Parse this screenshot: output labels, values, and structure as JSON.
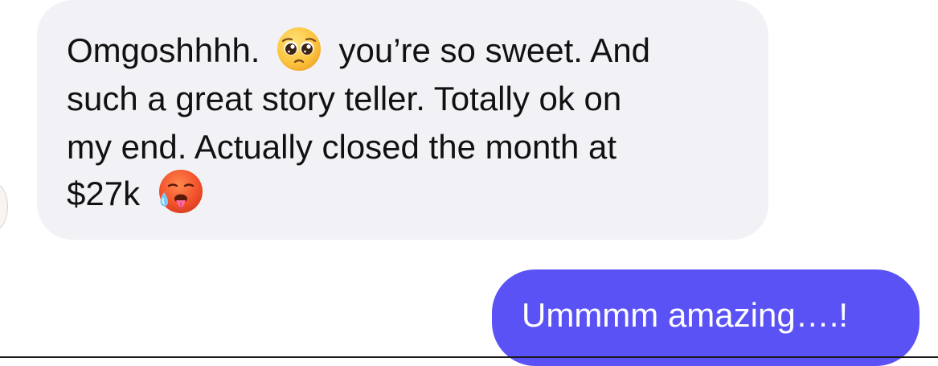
{
  "incoming_message": {
    "lines": [
      {
        "before": "Omgoshhhh.",
        "emoji": "pleading-face-emoji",
        "after": "you’re so sweet. And"
      },
      {
        "text": "such a great story teller. Totally ok on"
      },
      {
        "text": "my end. Actually closed the month at"
      },
      {
        "before": "$27k",
        "emoji": "hot-face-emoji"
      }
    ]
  },
  "outgoing_message": {
    "text": "Ummmm amazing….!"
  },
  "colors": {
    "incoming_bubble": "#f2f2f6",
    "outgoing_bubble": "#5b52f6",
    "incoming_text": "#111111",
    "outgoing_text": "#ffffff"
  }
}
